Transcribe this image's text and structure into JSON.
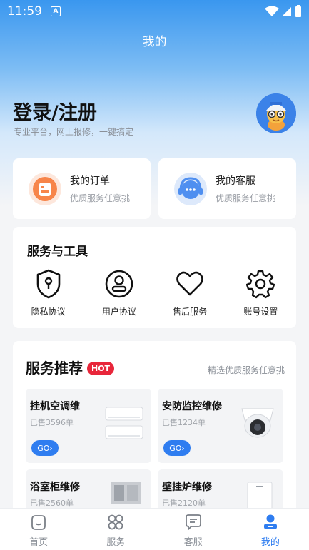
{
  "status": {
    "time": "11:59",
    "indicator": "A"
  },
  "header": {
    "title": "我的"
  },
  "login": {
    "title": "登录/注册",
    "subtitle": "专业平台，网上报修，一键搞定"
  },
  "quick": [
    {
      "title": "我的订单",
      "subtitle": "优质服务任意挑",
      "icon": "order-icon"
    },
    {
      "title": "我的客服",
      "subtitle": "优质服务任意挑",
      "icon": "customer-service-icon"
    }
  ],
  "tools": {
    "title": "服务与工具",
    "items": [
      {
        "label": "隐私协议",
        "icon": "shield-lock-icon"
      },
      {
        "label": "用户协议",
        "icon": "user-icon"
      },
      {
        "label": "售后服务",
        "icon": "heart-icon"
      },
      {
        "label": "账号设置",
        "icon": "gear-icon"
      }
    ]
  },
  "recommend": {
    "title": "服务推荐",
    "badge": "HOT",
    "hint": "精选优质服务任意挑",
    "go_label": "GO",
    "items": [
      {
        "title": "挂机空调维",
        "sold": "已售3596单"
      },
      {
        "title": "安防监控维修",
        "sold": "已售1234单"
      },
      {
        "title": "浴室柜维修",
        "sold": "已售2560单"
      },
      {
        "title": "壁挂炉维修",
        "sold": "已售2120单"
      }
    ]
  },
  "tabbar": {
    "items": [
      {
        "label": "首页",
        "icon": "home-icon"
      },
      {
        "label": "服务",
        "icon": "grid-icon"
      },
      {
        "label": "客服",
        "icon": "chat-icon"
      },
      {
        "label": "我的",
        "icon": "profile-icon",
        "active": true
      }
    ]
  },
  "colors": {
    "primary": "#2f7df0",
    "hot": "#e8263a",
    "orange": "#f7854a"
  }
}
